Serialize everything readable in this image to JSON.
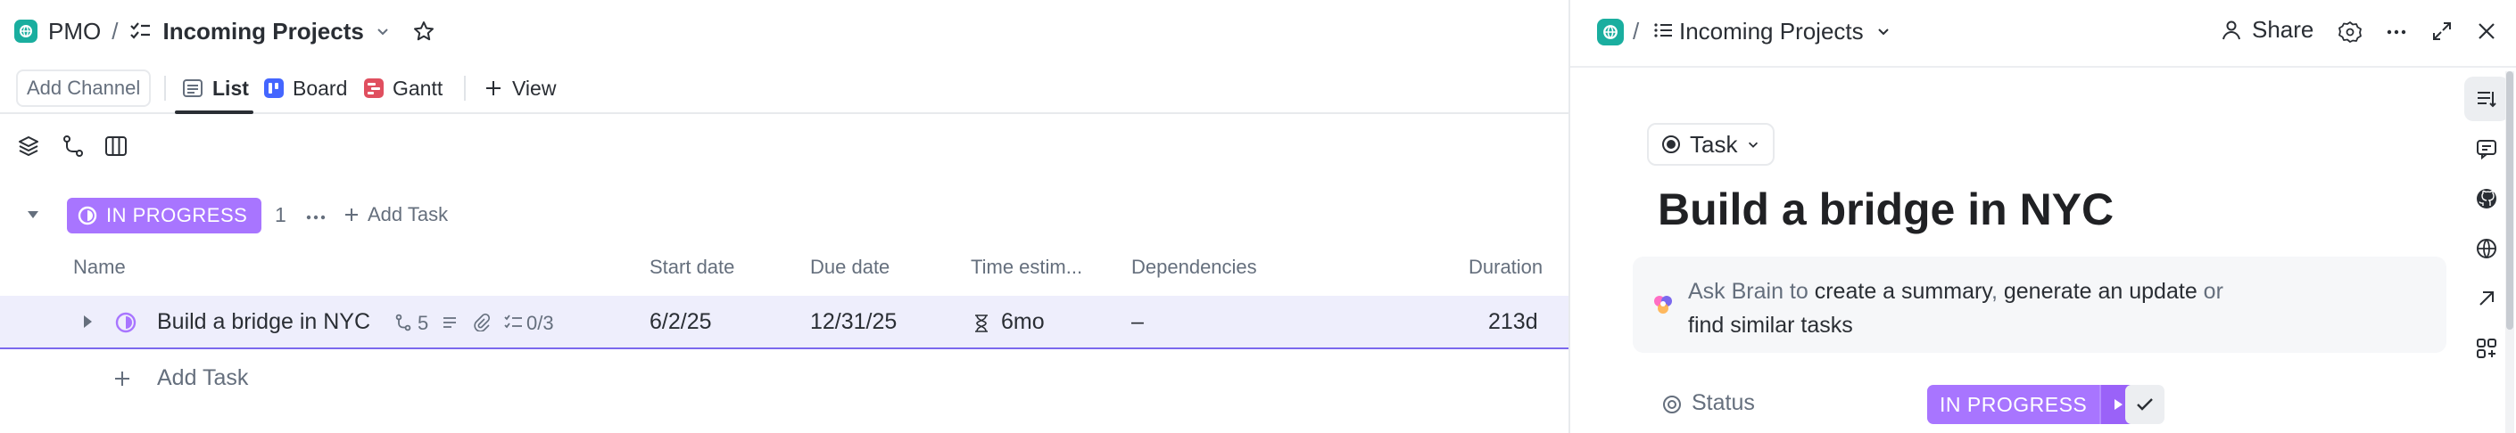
{
  "breadcrumb": {
    "space": "PMO",
    "sep": "/",
    "list": "Incoming Projects"
  },
  "tabs": {
    "add_channel": "Add Channel",
    "list": "List",
    "board": "Board",
    "gantt": "Gantt",
    "view": "View"
  },
  "group": {
    "status": "IN PROGRESS",
    "count": "1",
    "add_task": "Add Task"
  },
  "columns": {
    "name": "Name",
    "start": "Start date",
    "due": "Due date",
    "estimate": "Time estim...",
    "deps": "Dependencies",
    "duration": "Duration"
  },
  "task": {
    "name": "Build a bridge in NYC",
    "subtasks": "5",
    "checklist": "0/3",
    "start": "6/2/25",
    "due": "12/31/25",
    "estimate": "6mo",
    "deps": "–",
    "duration": "213d"
  },
  "add_task_row": "Add Task",
  "detail": {
    "sep": "/",
    "list": "Incoming Projects",
    "share": "Share",
    "type": "Task",
    "title": "Build a bridge in NYC",
    "brain_prefix": "Ask Brain to",
    "brain_a": "create a summary",
    "brain_comma": ",",
    "brain_b": "generate an update",
    "brain_or": "or",
    "brain_c": "find similar tasks",
    "status_label": "Status",
    "status_value": "IN PROGRESS"
  },
  "colors": {
    "status_purple": "#a875ff",
    "space_green": "#1aae9f",
    "board_blue": "#4466ff",
    "gantt_red": "#e04f5f"
  },
  "icons": [
    "space-icon",
    "list-icon",
    "chevron-down-icon",
    "star-icon",
    "board-icon",
    "gantt-icon",
    "plus-icon",
    "layers-icon",
    "route-icon",
    "columns-icon",
    "caret-down-icon",
    "ellipsis-icon",
    "caret-right-icon",
    "status-ring-icon",
    "subtask-icon",
    "description-icon",
    "paperclip-icon",
    "checklist-icon",
    "hourglass-icon",
    "share-icon",
    "settings-icon",
    "expand-icon",
    "close-icon",
    "task-type-icon",
    "brain-icon",
    "status-icon",
    "check-icon",
    "details-icon",
    "comment-icon",
    "github-icon",
    "globe-icon",
    "arrow-up-right-icon",
    "apps-icon"
  ]
}
